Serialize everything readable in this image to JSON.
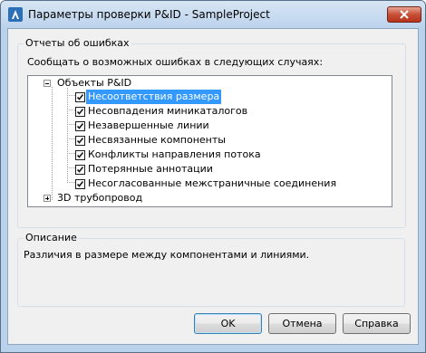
{
  "window": {
    "title": "Параметры проверки P&ID - SampleProject"
  },
  "error_reports": {
    "legend": "Отчеты об ошибках",
    "prompt": "Сообщать о возможных ошибках в следующих случаях:",
    "tree": {
      "root": {
        "label": "Объекты P&ID",
        "expanded": true
      },
      "items": [
        {
          "label": "Несоответствия размера",
          "checked": true,
          "selected": true
        },
        {
          "label": "Несовпадения миникаталогов",
          "checked": true,
          "selected": false
        },
        {
          "label": "Незавершенные линии",
          "checked": true,
          "selected": false
        },
        {
          "label": "Несвязанные компоненты",
          "checked": true,
          "selected": false
        },
        {
          "label": "Конфликты направления потока",
          "checked": true,
          "selected": false
        },
        {
          "label": "Потерянные аннотации",
          "checked": true,
          "selected": false
        },
        {
          "label": "Несогласованные межстраничные соединения",
          "checked": true,
          "selected": false
        }
      ],
      "root2": {
        "label": "3D трубопровод",
        "expanded": false
      }
    }
  },
  "description": {
    "legend": "Описание",
    "text": "Различия в размере между компонентами и линиями."
  },
  "buttons": {
    "ok": "OK",
    "cancel": "Отмена",
    "help": "Справка"
  },
  "colors": {
    "selection": "#3399ff",
    "title_bar": "#bcd3ec",
    "close_button": "#c75038"
  }
}
